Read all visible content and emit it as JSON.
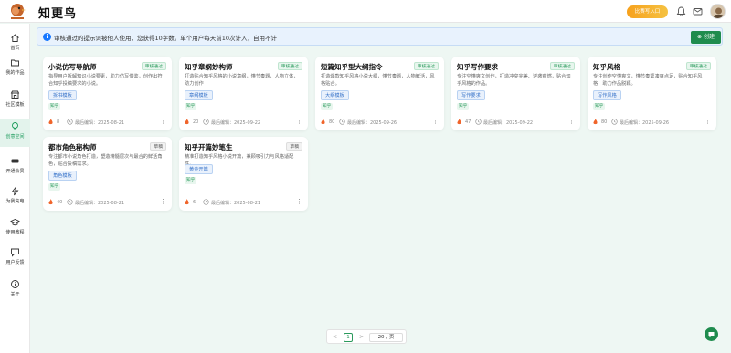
{
  "app": {
    "name": "知更鸟",
    "logo_caption": "知更鸟"
  },
  "header": {
    "creator_button": "比赛写入口",
    "brand_color": "#1f8c4e"
  },
  "sidebar": {
    "items": [
      {
        "label": "首页",
        "icon": "home-icon"
      },
      {
        "label": "我的作品",
        "icon": "folder-icon"
      },
      {
        "label": "社区模板",
        "icon": "store-icon"
      },
      {
        "label": "创意空间",
        "icon": "bulb-icon",
        "active": true
      },
      {
        "label": "开通会员",
        "icon": "vip-icon"
      },
      {
        "label": "为我充电",
        "icon": "bolt-icon"
      },
      {
        "label": "使用教程",
        "icon": "cap-icon"
      },
      {
        "label": "用户反馈",
        "icon": "chat-icon"
      },
      {
        "label": "关于",
        "icon": "info-icon"
      }
    ]
  },
  "notice": {
    "text": "审核通过的提示词被他人使用，您获得10字数。单个用户每天前10次计入，自用不计"
  },
  "toolbar": {
    "create_label": "创建"
  },
  "cards": [
    {
      "title": "小说仿写导航师",
      "status": "审核通过",
      "desc": "指导用户拆解知识小说要素，助力仿写借鉴，创作出符合知乎投稿要求的小说。",
      "template": "拆书模板",
      "platform": "知乎",
      "count": "8",
      "date_label": "最后编辑：2025-08-21"
    },
    {
      "title": "知乎章纲妙构师",
      "status": "审核通过",
      "desc": "打造贴合知乎风格的小说章纲，懂节奏题，人物立体，助力创作",
      "template": "章纲模板",
      "platform": "知乎",
      "count": "20",
      "date_label": "最后编辑：2025-09-22"
    },
    {
      "title": "短篇知乎型大纲指令",
      "status": "审核通过",
      "desc": "打造爆款知乎风格小说大纲，懂节奏题，人物鲜活，风格贴合。",
      "template": "大纲模板",
      "platform": "知乎",
      "count": "80",
      "date_label": "最后编辑：2025-09-26"
    },
    {
      "title": "知乎写作要求",
      "status": "审核通过",
      "desc": "专注空懂爽文创作，打造冲突完美、逆袭爽燃，贴合知乎风格的作品。",
      "template": "写作要求",
      "platform": "知乎",
      "count": "47",
      "date_label": "最后编辑：2025-09-22"
    },
    {
      "title": "知乎风格",
      "status": "审核通过",
      "desc": "专注创作空懂爽文，懂节奏紧凑爽点足，贴合知乎风格，助力作品脱颖。",
      "template": "写作风格",
      "platform": "知乎",
      "count": "80",
      "date_label": "最后编辑：2025-09-26"
    },
    {
      "title": "都市角色秘构师",
      "status": "草稿",
      "desc": "专注都市小说角色打造，塑造精髓层次与最合的鲜活角色，贴合投稿需求。",
      "template": "角色模板",
      "platform": "知乎",
      "count": "40",
      "date_label": "最后编辑：2025-08-21"
    },
    {
      "title": "知乎开篇妙笔生",
      "status": "草稿",
      "desc": "精准打造知乎风格小说开篇，兼顾吸引力与风格适配性。",
      "template": "黄金开篇",
      "platform": "知乎",
      "count": "6",
      "date_label": "最后编辑：2025-08-21"
    }
  ],
  "pagination": {
    "prev": "<",
    "page": "1",
    "next": ">",
    "page_size": "20 / 页"
  }
}
